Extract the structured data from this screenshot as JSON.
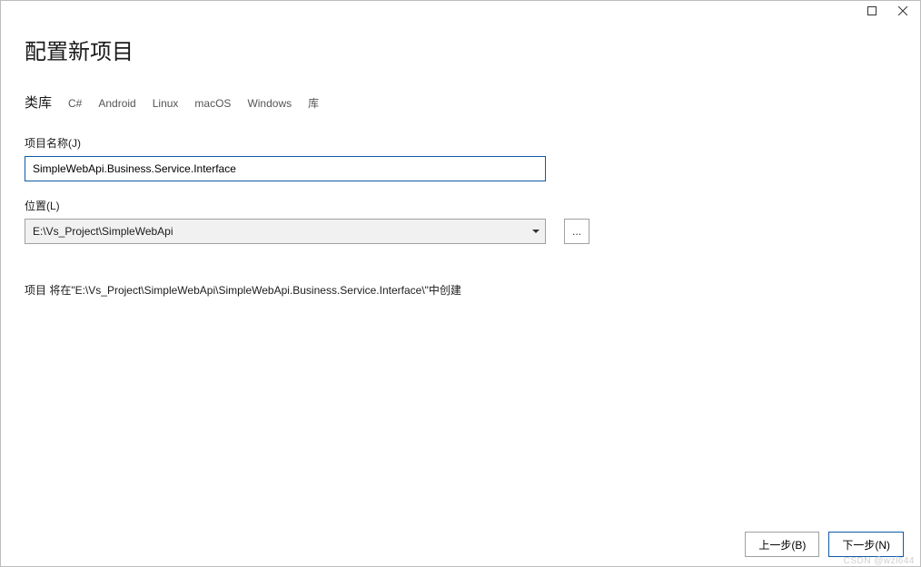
{
  "header": {
    "title": "配置新项目"
  },
  "subtitle": {
    "text": "类库",
    "tags": [
      "C#",
      "Android",
      "Linux",
      "macOS",
      "Windows",
      "库"
    ]
  },
  "fields": {
    "projectName": {
      "label": "项目名称(J)",
      "value": "SimpleWebApi.Business.Service.Interface"
    },
    "location": {
      "label": "位置(L)",
      "value": "E:\\Vs_Project\\SimpleWebApi",
      "browse": "..."
    }
  },
  "info": "项目 将在\"E:\\Vs_Project\\SimpleWebApi\\SimpleWebApi.Business.Service.Interface\\\"中创建",
  "footer": {
    "back": "上一步(B)",
    "next": "下一步(N)"
  },
  "watermark": "CSDN @wzl644"
}
